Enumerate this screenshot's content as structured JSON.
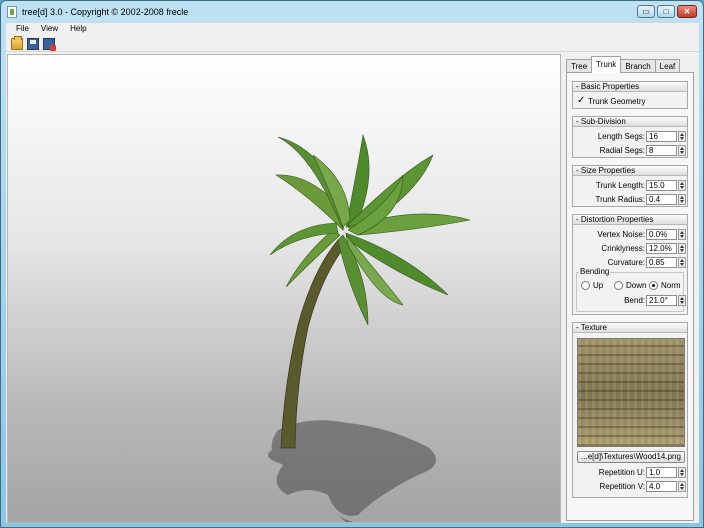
{
  "window": {
    "title": "tree[d] 3.0 - Copyright © 2002-2008 frecle",
    "minimize_label": "▭",
    "maximize_label": "□",
    "close_label": "✕"
  },
  "menu": [
    "File",
    "View",
    "Help"
  ],
  "toolbar": {
    "icons": [
      "open-folder-icon",
      "save-icon",
      "export-icon"
    ]
  },
  "tabs": [
    {
      "label": "Tree",
      "active": false
    },
    {
      "label": "Trunk",
      "active": true
    },
    {
      "label": "Branch",
      "active": false
    },
    {
      "label": "Leaf",
      "active": false
    }
  ],
  "basic": {
    "header": "- Basic Properties",
    "trunk_geometry_label": "Trunk Geometry",
    "trunk_geometry_checked": true,
    "check_mark": "✓"
  },
  "subdivision": {
    "header": "- Sub-Division",
    "length_segs_label": "Length Segs:",
    "length_segs": "16",
    "radial_segs_label": "Radial Segs:",
    "radial_segs": "8"
  },
  "size": {
    "header": "- Size Properties",
    "trunk_length_label": "Trunk Length:",
    "trunk_length": "15.0",
    "trunk_radius_label": "Trunk Radius:",
    "trunk_radius": "0.4"
  },
  "distortion": {
    "header": "- Distortion Properties",
    "vertex_noise_label": "Vertex Noise:",
    "vertex_noise": "0.0%",
    "crinklyness_label": "Crinklyness:",
    "crinklyness": "12.0%",
    "curvature_label": "Curvature:",
    "curvature": "0.85",
    "bending": {
      "label": "Bending",
      "up_label": "Up",
      "down_label": "Down",
      "norm_label": "Norm",
      "selected": "Norm",
      "bend_label": "Bend:",
      "bend": "21.0°"
    }
  },
  "texture": {
    "header": "- Texture",
    "path": "...e[d]\\Textures\\Wood14.png",
    "repetition_u_label": "Repetition U:",
    "repetition_u": "1.0",
    "repetition_v_label": "Repetition V:",
    "repetition_v": "4.0"
  },
  "colors": {
    "foliage": "#4f8a2c",
    "trunk": "#5a5a2c",
    "shadow": "#4a4a4a"
  }
}
